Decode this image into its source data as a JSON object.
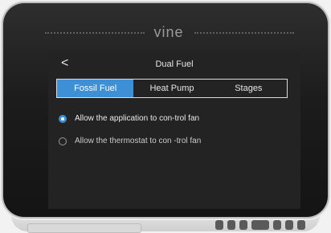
{
  "device": {
    "brand": "vine"
  },
  "header": {
    "back_icon": "chevron-left-icon",
    "back_glyph": "<",
    "title": "Dual Fuel"
  },
  "tabs": [
    {
      "label": "Fossil Fuel",
      "active": true
    },
    {
      "label": "Heat Pump",
      "active": false
    },
    {
      "label": "Stages",
      "active": false
    }
  ],
  "options": [
    {
      "label": "Allow the application to con-trol fan",
      "selected": true
    },
    {
      "label": "Allow the thermostat to con -trol fan",
      "selected": false
    }
  ],
  "colors": {
    "accent": "#3d8fd6",
    "screen_bg": "#232323",
    "bezel": "#1c1c1c"
  }
}
